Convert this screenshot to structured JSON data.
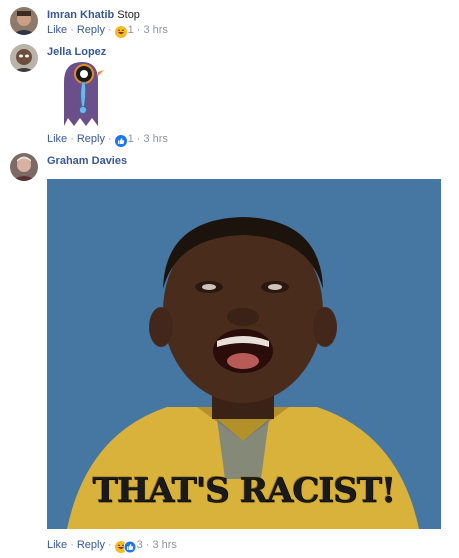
{
  "comments": [
    {
      "author": "Imran Khatib",
      "text": "Stop",
      "actions": {
        "like": "Like",
        "reply": "Reply"
      },
      "reaction_count": "1",
      "reactions": [
        "haha-icon"
      ],
      "time": "3 hrs"
    },
    {
      "author": "Jella Lopez",
      "text": "",
      "attachment": "crying-bird-sticker",
      "actions": {
        "like": "Like",
        "reply": "Reply"
      },
      "reaction_count": "1",
      "reactions": [
        "like-icon"
      ],
      "time": "3 hrs"
    },
    {
      "author": "Graham Davies",
      "text": "",
      "attachment": "gif",
      "gif_caption": "THAT'S RACIST!",
      "actions": {
        "like": "Like",
        "reply": "Reply"
      },
      "reaction_count": "3",
      "reactions": [
        "haha-icon",
        "like-icon"
      ],
      "time": "3 hrs"
    }
  ],
  "separator": "·",
  "colors": {
    "link": "#385898",
    "meta": "#90949c",
    "text": "#1c1e21",
    "like_blue": "#1877f2",
    "haha_yellow": "#f7b928",
    "gif_background": "#4a7aa7",
    "gif_shirt": "#d8b23a"
  }
}
